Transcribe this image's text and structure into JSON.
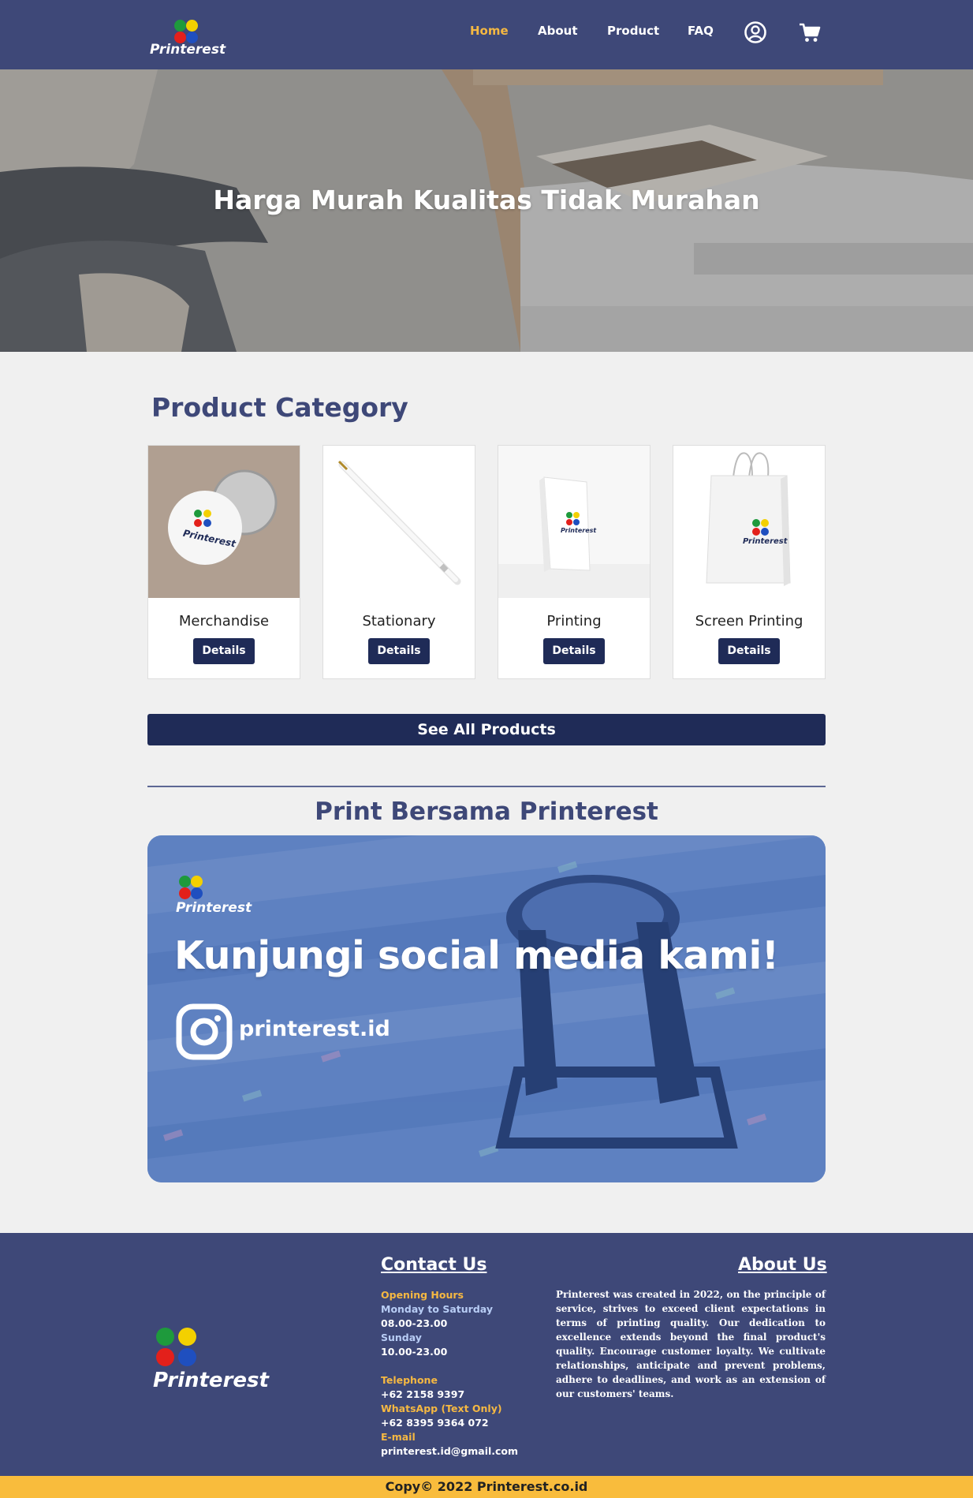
{
  "brand": {
    "name": "Printerest",
    "dot_colors": [
      "#1e9a3c",
      "#f3d000",
      "#e3201b",
      "#1f4fbf"
    ]
  },
  "nav": {
    "items": [
      {
        "label": "Home",
        "active": true
      },
      {
        "label": "About",
        "active": false
      },
      {
        "label": "Product",
        "active": false
      },
      {
        "label": "FAQ",
        "active": false
      }
    ],
    "icons": [
      "user-circle-icon",
      "shopping-cart-icon"
    ]
  },
  "hero": {
    "title": "Harga Murah Kualitas Tidak Murahan"
  },
  "product_category": {
    "title": "Product Category",
    "cards": [
      {
        "label": "Merchandise",
        "button": "Details",
        "image": "pin-button-image"
      },
      {
        "label": "Stationary",
        "button": "Details",
        "image": "pen-image"
      },
      {
        "label": "Printing",
        "button": "Details",
        "image": "printed-book-image"
      },
      {
        "label": "Screen Printing",
        "button": "Details",
        "image": "shopping-bag-image"
      }
    ],
    "see_all": "See All Products"
  },
  "print_section": {
    "title": "Print Bersama Printerest",
    "banner": {
      "headline": "Kunjungi social media kami!",
      "handle": "printerest.id",
      "icon": "instagram-icon"
    }
  },
  "footer": {
    "contact": {
      "title": "Contact Us",
      "opening_hours_label": "Opening Hours",
      "weekday_label": "Monday to Saturday",
      "weekday_hours": "08.00-23.00",
      "sunday_label": "Sunday",
      "sunday_hours": "10.00-23.00",
      "telephone_label": "Telephone",
      "telephone": "+62 2158 9397",
      "whatsapp_label": "WhatsApp (Text Only)",
      "whatsapp": "+62 8395 9364 072",
      "email_label": "E-mail",
      "email": "printerest.id@gmail.com"
    },
    "about": {
      "title": "About Us",
      "text": "Printerest was created in 2022, on the principle of service, strives to exceed client expectations in terms of printing quality. Our dedication to excellence extends beyond the final product's quality. Encourage customer loyalty. We cultivate relationships, anticipate and prevent problems, adhere to deadlines, and work as an extension of our customers' teams."
    },
    "copyright": "Copy© 2022 Printerest.co.id"
  },
  "colors": {
    "primary": "#3e4878",
    "dark_button": "#1f2b57",
    "accent": "#f5b842",
    "footer_bar": "#f9bc3c"
  }
}
